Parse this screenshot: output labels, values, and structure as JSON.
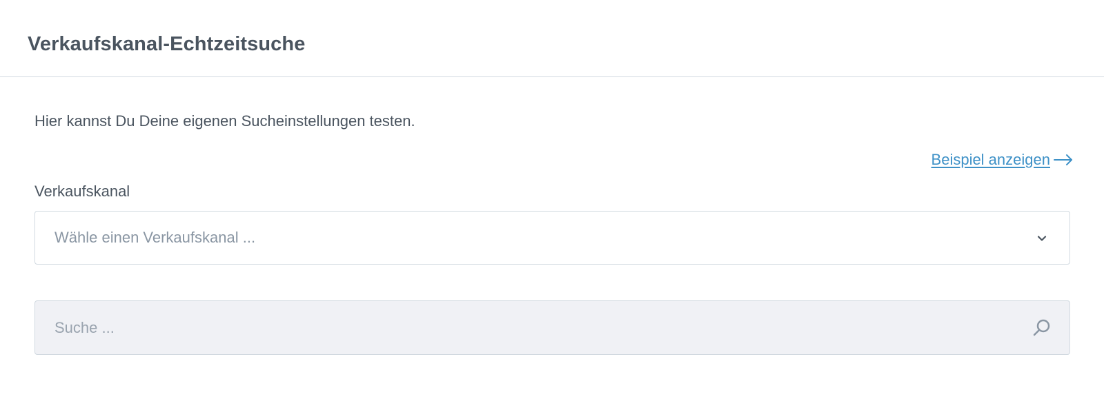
{
  "header": {
    "title": "Verkaufskanal-Echtzeitsuche"
  },
  "body": {
    "intro": "Hier kannst Du Deine eigenen Sucheinstellungen testen.",
    "example_link": "Beispiel anzeigen",
    "sales_channel": {
      "label": "Verkaufskanal",
      "placeholder": "Wähle einen Verkaufskanal ..."
    },
    "search": {
      "placeholder": "Suche ..."
    }
  },
  "icons": {
    "arrow": "arrow-right-icon",
    "chevron": "chevron-down-icon",
    "search": "search-icon"
  },
  "colors": {
    "link": "#3e91c7",
    "text": "#4a545f",
    "placeholder": "#8a96a3",
    "border": "#d1d9e0",
    "search_background": "#f0f1f5"
  }
}
